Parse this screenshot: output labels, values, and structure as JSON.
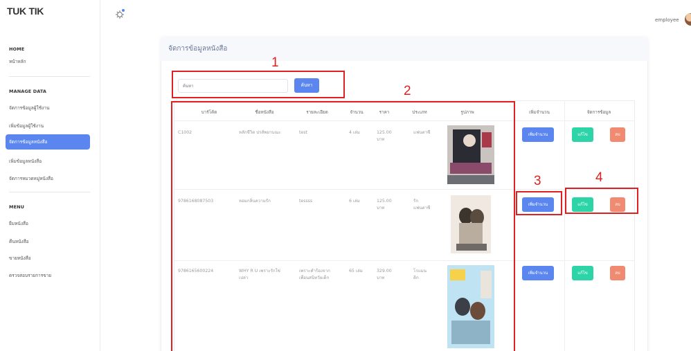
{
  "brand": "TUK TIK",
  "user": {
    "name": "employee"
  },
  "sidebar": {
    "home_title": "HOME",
    "home_items": [
      "หน้าหลัก"
    ],
    "manage_title": "MANAGE DATA",
    "manage_items": [
      "จัดการข้อมูลผู้ใช้งาน",
      "เพิ่มข้อมูลผู้ใช้งาน",
      "จัดการข้อมูลหนังสือ",
      "เพิ่มข้อมูลหนังสือ",
      "จัดการหมวดหมู่หนังสือ"
    ],
    "menu_title": "MENU",
    "menu_items": [
      "ยืมหนังสือ",
      "คืนหนังสือ",
      "ขายหนังสือ",
      "ตรวจสอบรายการขาย"
    ]
  },
  "page": {
    "title": "จัดการข้อมูลหนังสือ"
  },
  "search": {
    "placeholder": "ค้นหา",
    "button": "ค้นหา"
  },
  "table": {
    "headers": [
      "บาร์โค้ด",
      "ชื่อหนังสือ",
      "รายละเอียด",
      "จำนวน",
      "ราคา",
      "ประเภท",
      "รูปภาพ",
      "เพิ่มจำนวน",
      "จัดการข้อมูล"
    ],
    "rows": [
      {
        "barcode": "C1002",
        "title": "หลักชีวิต ปรส์พยาบณะ",
        "detail": "test",
        "qty": "4 เล่ม",
        "price": "125.00",
        "unit": "บาท",
        "type": "แฟนตาซี",
        "type2": ""
      },
      {
        "barcode": "9786168087503",
        "title": "หอมกลิ่นความรัก",
        "detail": "tessss",
        "qty": "6 เล่ม",
        "price": "125.00",
        "unit": "บาท",
        "type": "รัก",
        "type2": "แฟนตาซี"
      },
      {
        "barcode": "9786165600224",
        "title": "WHY R U เพราะรักใช่",
        "title2": "เปล่า",
        "detail": "เพราะคำร้องจาก",
        "detail2": "เพื่อนสนิทวัยเด็ก",
        "qty": "65 เล่ม",
        "price": "329.00",
        "unit": "บาท",
        "type": "โรแมน",
        "type2": "ติก"
      }
    ],
    "add_label": "เพิ่มจำนวน",
    "edit_label": "แก้ไข",
    "delete_label": "ลบ"
  },
  "annotations": [
    "1",
    "2",
    "3",
    "4"
  ],
  "colors": {
    "primary": "#5b86f0",
    "edit": "#2dd4a7",
    "delete": "#f08a70",
    "annotation": "#e02020"
  }
}
